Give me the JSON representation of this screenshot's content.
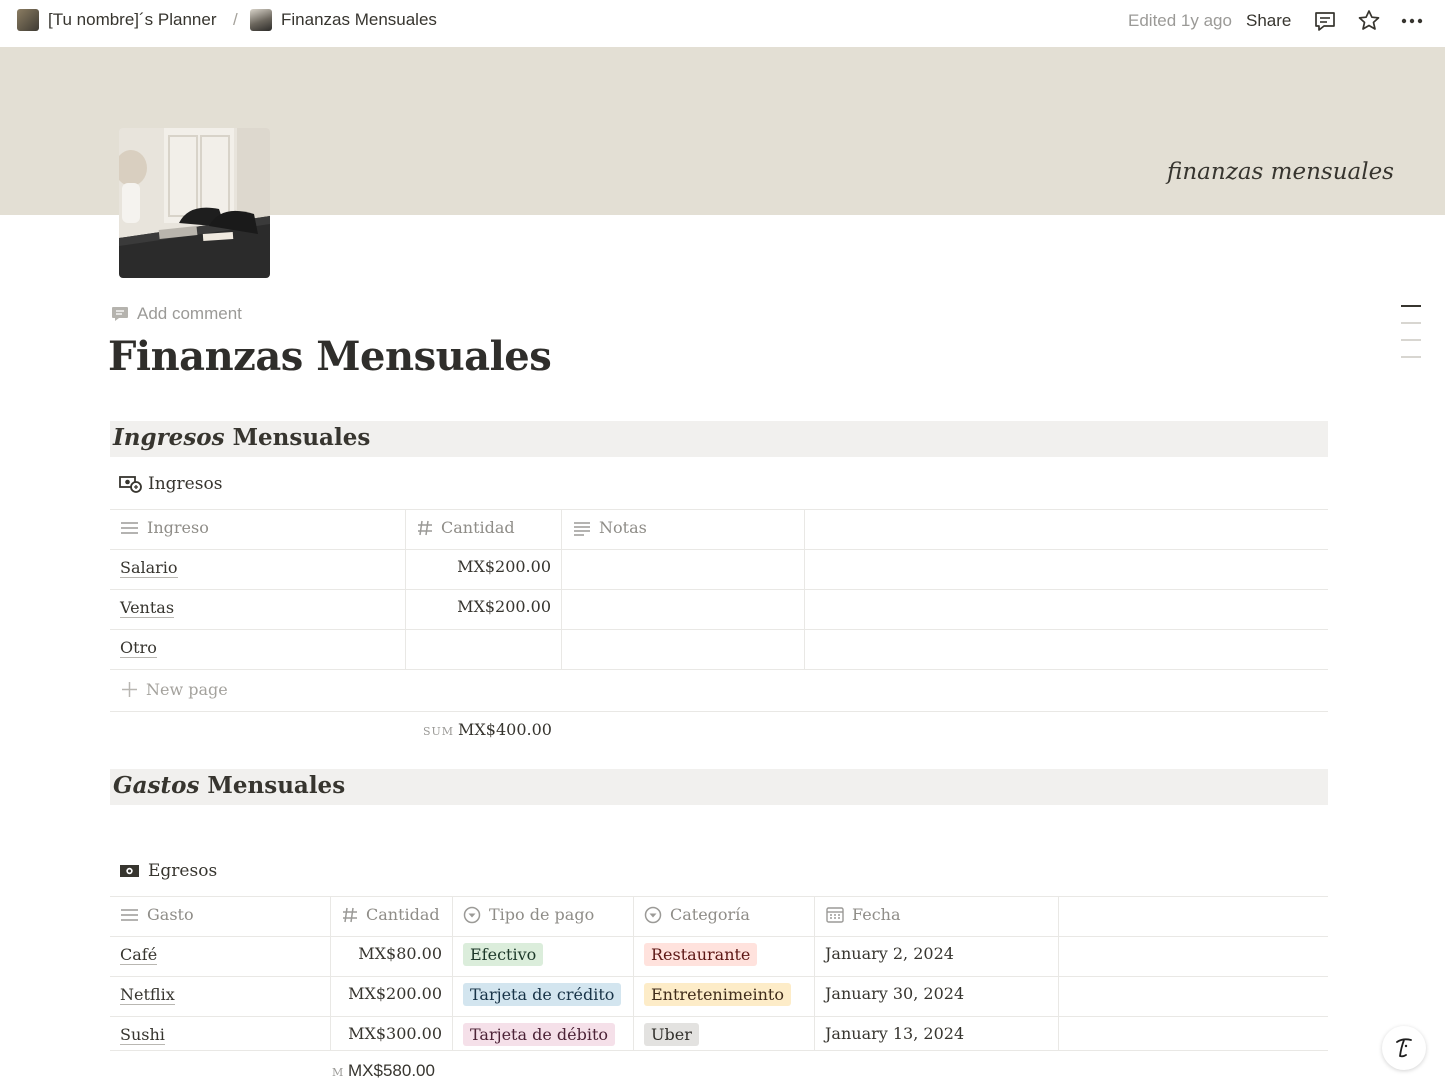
{
  "topbar": {
    "breadcrumb": [
      {
        "label": "[Tu nombre]´s Planner"
      },
      {
        "label": "Finanzas Mensuales"
      }
    ],
    "separator": "/",
    "edited": "Edited 1y ago",
    "share": "Share"
  },
  "cover": {
    "text": "finanzas mensuales"
  },
  "page": {
    "add_comment": "Add comment",
    "title": "Finanzas Mensuales"
  },
  "ingresos_section": {
    "italic": "Ingresos",
    "rest": " Mensuales"
  },
  "ingresos_db": {
    "title": "Ingresos",
    "headers": [
      "Ingreso",
      "Cantidad",
      "Notas"
    ],
    "rows": [
      {
        "name": "Salario",
        "amount": "MX$200.00",
        "notes": ""
      },
      {
        "name": "Ventas",
        "amount": "MX$200.00",
        "notes": ""
      },
      {
        "name": "Otro",
        "amount": "",
        "notes": ""
      }
    ],
    "new_page": "New page",
    "sum_label": "SUM",
    "sum_value": "MX$400.00"
  },
  "gastos_section": {
    "italic": "Gastos",
    "rest": " Mensuales"
  },
  "egresos_db": {
    "title": "Egresos",
    "headers": [
      "Gasto",
      "Cantidad",
      "Tipo de pago",
      "Categoría",
      "Fecha"
    ],
    "rows": [
      {
        "name": "Café",
        "amount": "MX$80.00",
        "pago": "Efectivo",
        "categoria": "Restaurante",
        "fecha": "January 2, 2024"
      },
      {
        "name": "Netflix",
        "amount": "MX$200.00",
        "pago": "Tarjeta de crédito",
        "categoria": "Entretenimeinto",
        "fecha": "January 30, 2024"
      },
      {
        "name": "Sushi",
        "amount": "MX$300.00",
        "pago": "Tarjeta de débito",
        "categoria": "Uber",
        "fecha": "January 13, 2024"
      }
    ],
    "sum_label": "M",
    "sum_value": "MX$580.00"
  },
  "colors": {
    "tag_green": "#dbeddb",
    "tag_blue": "#d3e5ef",
    "tag_pink": "#f5e0e9",
    "tag_red": "#ffe2dd",
    "tag_orange": "#fdecc8",
    "tag_gray": "#e3e2e0",
    "cover": "#e3dfd4"
  }
}
